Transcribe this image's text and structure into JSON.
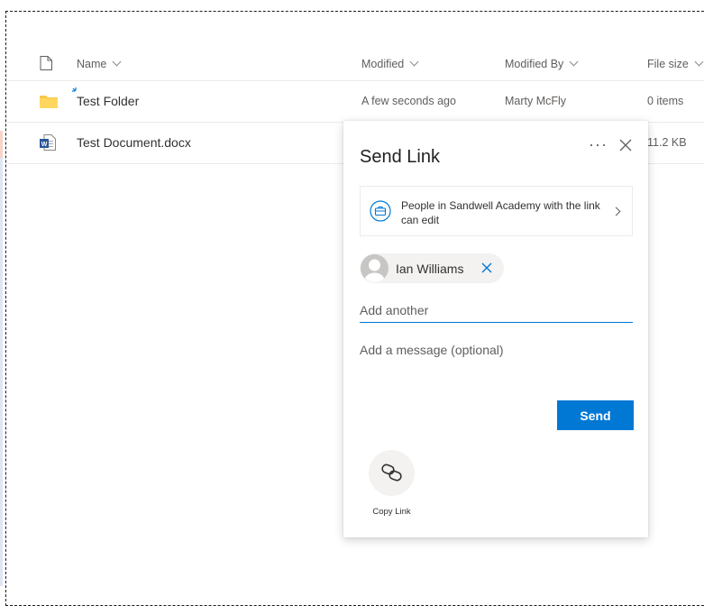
{
  "columns": {
    "name": "Name",
    "modified": "Modified",
    "modified_by": "Modified By",
    "file_size": "File size"
  },
  "rows": [
    {
      "name": "Test Folder",
      "modified": "A few seconds ago",
      "modified_by": "Marty McFly",
      "size": "0 items",
      "icon": "folder-icon"
    },
    {
      "name": "Test Document.docx",
      "modified": "",
      "modified_by": "",
      "size": "11.2 KB",
      "icon": "word-document-icon"
    }
  ],
  "panel": {
    "title": "Send Link",
    "more_label": "···",
    "permission_text": "People in Sandwell Academy with the link can edit",
    "recipient": "Ian Williams",
    "add_placeholder": "Add another",
    "message_placeholder": "Add a message (optional)",
    "send_label": "Send",
    "copy_label": "Copy Link"
  },
  "colors": {
    "accent": "#0078d4",
    "folder": "#f8c845",
    "word": "#2b579a"
  }
}
